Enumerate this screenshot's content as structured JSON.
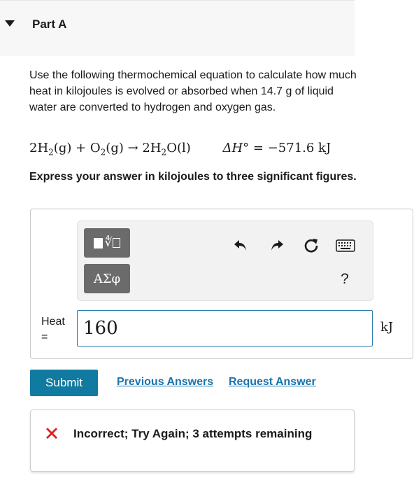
{
  "part": {
    "title": "Part A"
  },
  "question": {
    "text": "Use the following thermochemical equation to calculate how much heat in kilojoules is evolved or absorbed when 14.7 g of liquid water are converted to hydrogen and oxygen gas."
  },
  "equation": {
    "reaction_parts": [
      "2H",
      "2",
      "(g) + O",
      "2",
      "(g) → 2H",
      "2",
      "O(l)"
    ],
    "delta_h_symbol": "ΔH°",
    "delta_h_value": "= −571.6 kJ"
  },
  "instruction": "Express your answer in kilojoules to three significant figures.",
  "toolbar": {
    "greek_label": "ΑΣφ",
    "help_label": "?",
    "icons": [
      "templates-icon",
      "undo-icon",
      "redo-icon",
      "reset-icon",
      "keyboard-icon"
    ]
  },
  "answer": {
    "label": "Heat =",
    "value": "160",
    "unit": "kJ"
  },
  "actions": {
    "submit_label": "Submit",
    "previous_answers_label": "Previous Answers",
    "request_answer_label": "Request Answer"
  },
  "feedback": {
    "text": "Incorrect; Try Again; 3 attempts remaining",
    "color": "#e0201f"
  },
  "colors": {
    "accent": "#117aa0",
    "link": "#1a74ad",
    "input_border": "#2a7ab0"
  }
}
